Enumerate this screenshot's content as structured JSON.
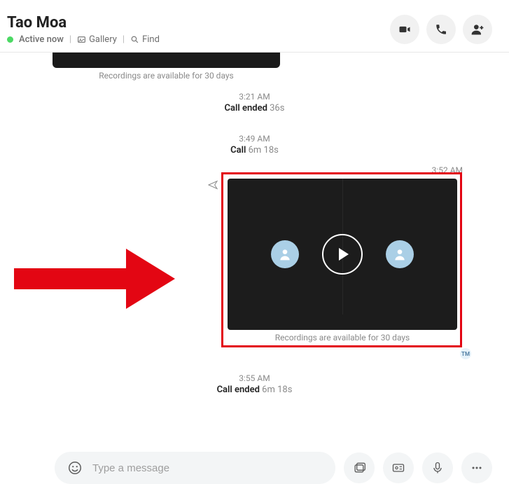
{
  "header": {
    "contact_name": "Tao Moa",
    "status": "Active now",
    "gallery_label": "Gallery",
    "find_label": "Find"
  },
  "recording": {
    "caption": "Recordings are available for 30 days"
  },
  "events": [
    {
      "time": "3:21 AM",
      "title": "Call ended",
      "duration": "36s"
    },
    {
      "time": "3:49 AM",
      "title": "Call",
      "duration": "6m 18s"
    },
    {
      "time": "3:52 AM",
      "title": "",
      "duration": ""
    },
    {
      "time": "3:55 AM",
      "title": "Call ended",
      "duration": "6m 18s"
    }
  ],
  "avatar_initials": "TM",
  "composer": {
    "placeholder": "Type a message"
  },
  "colors": {
    "highlight": "#e30613",
    "status_dot": "#4cd964"
  }
}
